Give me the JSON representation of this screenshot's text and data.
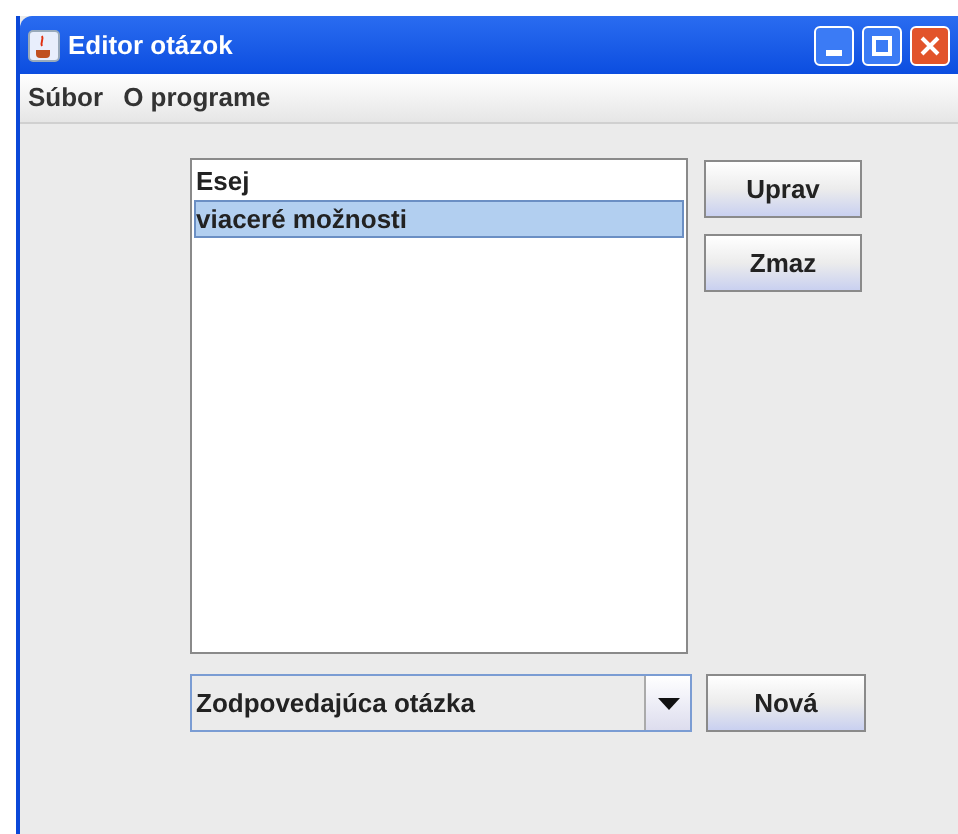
{
  "window": {
    "title": "Editor otázok"
  },
  "menu": [
    "Súbor",
    "O programe"
  ],
  "list": {
    "items": [
      {
        "label": "Esej",
        "selected": false
      },
      {
        "label": "viaceré možnosti",
        "selected": true
      }
    ]
  },
  "side_buttons": [
    "Uprav",
    "Zmaz"
  ],
  "dropdown": {
    "value": "Zodpovedajúca otázka"
  },
  "new_button": "Nová"
}
